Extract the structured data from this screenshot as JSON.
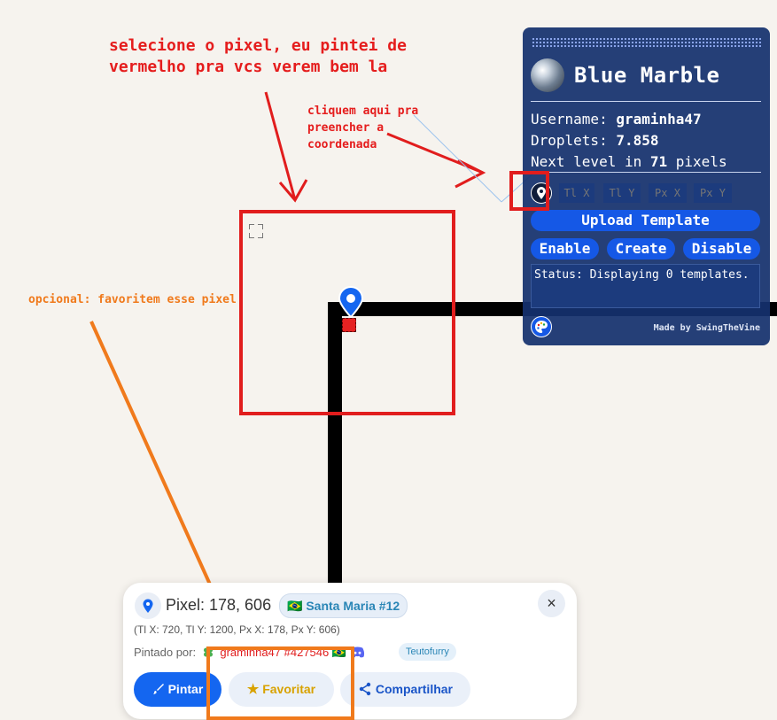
{
  "annotations": {
    "top_line1": "selecione o pixel, eu pintei de",
    "top_line2": "vermelho pra vcs verem bem la",
    "mid_line1": "cliquem aqui pra",
    "mid_line2": "preencher a",
    "mid_line3": "coordenada",
    "left": "opcional: favoritem esse pixel"
  },
  "blue_marble": {
    "title": "Blue Marble",
    "username_label": "Username:",
    "username": "graminha47",
    "droplets_label": "Droplets:",
    "droplets": "7.858",
    "next_level_prefix": "Next level in",
    "next_level_value": "71",
    "next_level_suffix": "pixels",
    "placeholders": {
      "tl_x": "Tl X",
      "tl_y": "Tl Y",
      "px_x": "Px X",
      "px_y": "Px Y"
    },
    "upload_label": "Upload Template",
    "enable_label": "Enable",
    "create_label": "Create",
    "disable_label": "Disable",
    "status": "Status: Displaying 0 templates.",
    "made_by": "Made by SwingTheVine",
    "colors": {
      "panel": "#14306e",
      "button": "#1558e6"
    },
    "icons": [
      "globe-logo-icon",
      "map-pin-icon",
      "palette-icon"
    ]
  },
  "pixel_card": {
    "title": "Pixel: 178, 606",
    "region_flag": "🇧🇷",
    "region": "Santa Maria #12",
    "close": "×",
    "coords": "(Tl X: 720, Tl Y: 1200, Px X: 178, Px Y: 606)",
    "painted_by_label": "Pintado por:",
    "painter": "graminha47 #427546",
    "painter_flag": "🇧🇷",
    "alliance": "Teutofurry",
    "paint_label": "Pintar",
    "favorite_label": "Favoritar",
    "share_label": "Compartilhar",
    "colors": {
      "primary": "#1466f0",
      "favorite": "#d8a200",
      "painter": "#e11d1d"
    }
  }
}
